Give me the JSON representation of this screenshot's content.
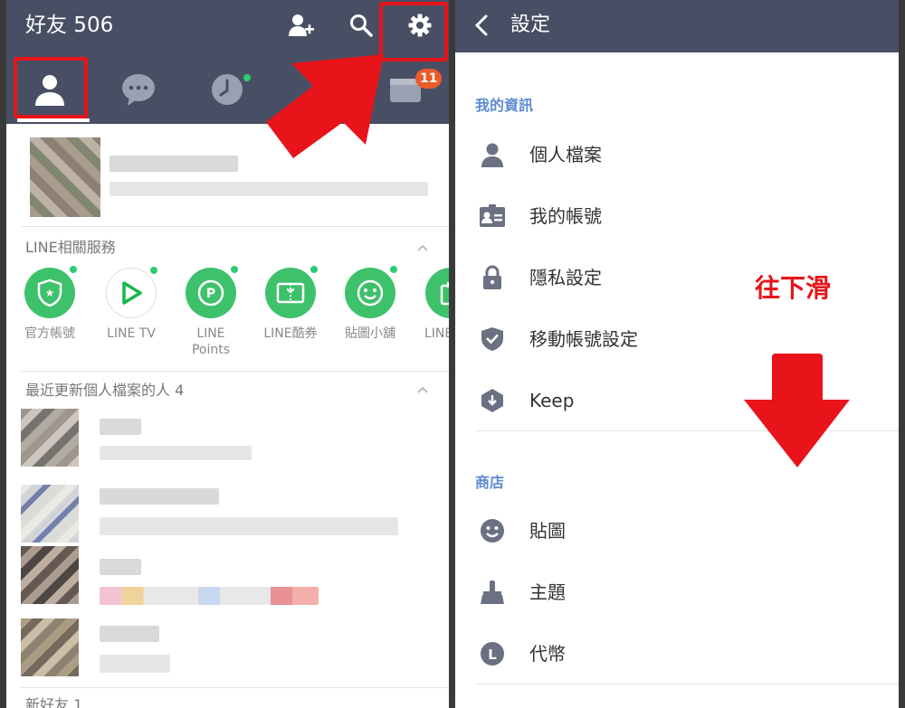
{
  "left": {
    "title": "好友 506",
    "icons": [
      "add-friend-icon",
      "search-icon",
      "settings-gear-icon"
    ],
    "tabs": [
      "friends-tab",
      "chats-tab",
      "timeline-tab",
      "wallet-tab"
    ],
    "wallet_badge": "11",
    "services_section": {
      "title": "LINE相關服務",
      "items": [
        {
          "label": "官方帳號",
          "icon": "official-account-icon",
          "color": "#3ec16b"
        },
        {
          "label": "LINE TV",
          "icon": "line-tv-play-icon",
          "color": "#ffffff"
        },
        {
          "label": "LINE\nPoints",
          "icon": "line-points-icon",
          "color": "#3ec16b"
        },
        {
          "label": "LINE酷券",
          "icon": "coupon-icon",
          "color": "#3ec16b"
        },
        {
          "label": "貼圖小舖",
          "icon": "sticker-shop-icon",
          "color": "#3ec16b"
        },
        {
          "label": "LINE",
          "icon": "gift-icon",
          "color": "#3ec16b"
        }
      ]
    },
    "recent_section": {
      "title": "最近更新個人檔案的人 4"
    },
    "new_friends_partial": "新好友 1"
  },
  "right": {
    "title": "設定",
    "sections": [
      {
        "title": "我的資訊",
        "items": [
          {
            "label": "個人檔案",
            "icon": "person-icon"
          },
          {
            "label": "我的帳號",
            "icon": "id-card-icon"
          },
          {
            "label": "隱私設定",
            "icon": "lock-icon"
          },
          {
            "label": "移動帳號設定",
            "icon": "shield-check-icon"
          },
          {
            "label": "Keep",
            "icon": "keep-icon"
          }
        ]
      },
      {
        "title": "商店",
        "items": [
          {
            "label": "貼圖",
            "icon": "smiley-icon"
          },
          {
            "label": "主題",
            "icon": "brush-icon"
          },
          {
            "label": "代幣",
            "icon": "coin-icon"
          }
        ]
      }
    ],
    "scroll_hint": "往下滑"
  },
  "colors": {
    "header": "#484f64",
    "accent_section": "#5c8ad1",
    "annotation_red": "#e8141a",
    "line_green": "#3ec16b",
    "badge": "#ea5b2a"
  }
}
